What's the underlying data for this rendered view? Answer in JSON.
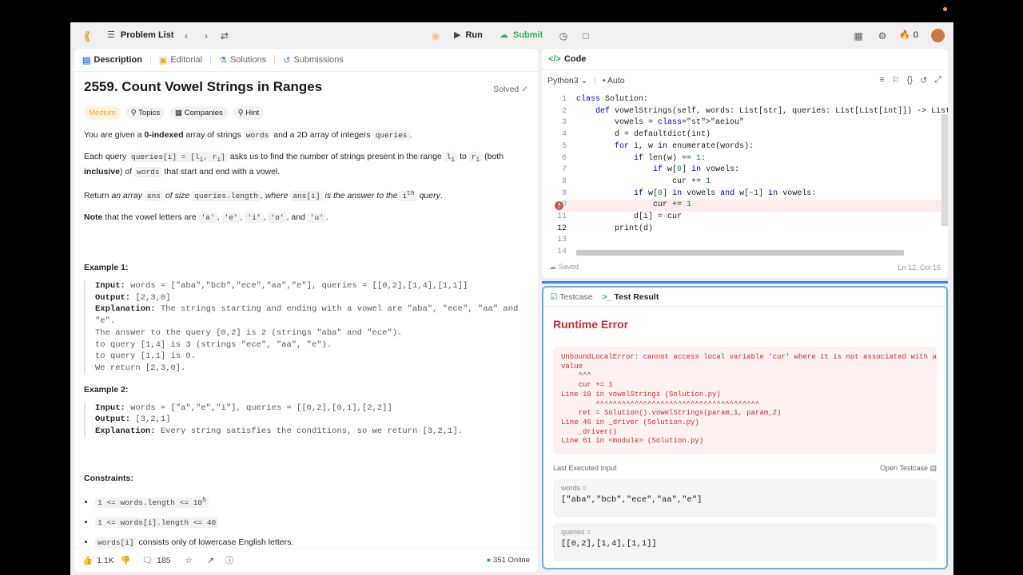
{
  "topbar": {
    "problem_list": "Problem List",
    "run": "Run",
    "submit": "Submit",
    "streak": "0"
  },
  "left_tabs": [
    {
      "label": "Description"
    },
    {
      "label": "Editorial"
    },
    {
      "label": "Solutions"
    },
    {
      "label": "Submissions"
    }
  ],
  "problem": {
    "title": "2559. Count Vowel Strings in Ranges",
    "status": "Solved",
    "difficulty": "Medium",
    "tags": [
      "Topics",
      "Companies",
      "Hint"
    ],
    "p1_a": "You are given a ",
    "p1_b": "0-indexed",
    "p1_c": " array of strings ",
    "p1_d": "words",
    "p1_e": " and a 2D array of integers ",
    "p1_f": "queries",
    "p1_g": ".",
    "p2_a": "Each query ",
    "p2_b": "queries[i] = [l",
    "p2_b2": "i",
    "p2_b3": ", r",
    "p2_b4": "i",
    "p2_b5": "]",
    "p2_c": " asks us to find the number of strings present in the range ",
    "p2_d": "l",
    "p2_d2": "i",
    "p2_e": " to ",
    "p2_f": "r",
    "p2_f2": "i",
    "p2_g": " (both ",
    "p2_h": "inclusive",
    "p2_i": ") of ",
    "p2_j": "words",
    "p2_k": " that start and end with a vowel.",
    "p3_a": "Return ",
    "p3_b": "an array ",
    "p3_c": "ans",
    "p3_d": " of size ",
    "p3_e": "queries.length",
    "p3_f": ", where ",
    "p3_g": "ans[i]",
    "p3_h": " is the answer to the ",
    "p3_i": "i",
    "p3_j": "th",
    "p3_k": " query",
    "p3_l": ".",
    "p4_a": "Note",
    "p4_b": " that the vowel letters are ",
    "p4_v1": "'a'",
    "p4_v2": "'e'",
    "p4_v3": "'i'",
    "p4_v4": "'o'",
    "p4_c": ", and ",
    "p4_v5": "'u'",
    "p4_d": ".",
    "ex1_title": "Example 1:",
    "ex1_lines": [
      {
        "k": "Input:",
        "v": " words = [\"aba\",\"bcb\",\"ece\",\"aa\",\"e\"], queries = [[0,2],[1,4],[1,1]]"
      },
      {
        "k": "Output:",
        "v": " [2,3,0]"
      },
      {
        "k": "Explanation:",
        "v": " The strings starting and ending with a vowel are \"aba\", \"ece\", \"aa\" and"
      },
      {
        "k": "",
        "v": "\"e\"."
      },
      {
        "k": "",
        "v": "The answer to the query [0,2] is 2 (strings \"aba\" and \"ece\")."
      },
      {
        "k": "",
        "v": "to query [1,4] is 3 (strings \"ece\", \"aa\", \"e\")."
      },
      {
        "k": "",
        "v": "to query [1,1] is 0."
      },
      {
        "k": "",
        "v": "We return [2,3,0]."
      }
    ],
    "ex2_title": "Example 2:",
    "ex2_lines": [
      {
        "k": "Input:",
        "v": " words = [\"a\",\"e\",\"i\"], queries = [[0,2],[0,1],[2,2]]"
      },
      {
        "k": "Output:",
        "v": " [3,2,1]"
      },
      {
        "k": "Explanation:",
        "v": " Every string satisfies the conditions, so we return [3,2,1]."
      }
    ],
    "constraints_title": "Constraints:",
    "c1": "1 <= words.length <= 10",
    "c1_sup": "5",
    "c2": "1 <= words[i].length <= 40",
    "c3_code": "words[i]",
    "c3_text": " consists only of lowercase English letters."
  },
  "bottom": {
    "likes": "1.1K",
    "comments": "185",
    "online": "351 Online"
  },
  "code": {
    "header": "Code",
    "language": "Python3",
    "mode": "Auto",
    "saved": "Saved",
    "cursor": "Ln 12, Col 16",
    "lines": [
      {
        "n": "1",
        "t": "class Solution:"
      },
      {
        "n": "2",
        "t": "    def vowelStrings(self, words: List[str], queries: List[List[int]]) -> List[in"
      },
      {
        "n": "3",
        "t": "        vowels = \"aeiou\""
      },
      {
        "n": "4",
        "t": "        d = defaultdict(int)"
      },
      {
        "n": "5",
        "t": "        for i, w in enumerate(words):"
      },
      {
        "n": "6",
        "t": "            if len(w) == 1:"
      },
      {
        "n": "7",
        "t": "                if w[0] in vowels:"
      },
      {
        "n": "8",
        "t": "                    cur += 1"
      },
      {
        "n": "9",
        "t": "            if w[0] in vowels and w[-1] in vowels:"
      },
      {
        "n": "10",
        "t": "                cur += 1"
      },
      {
        "n": "11",
        "t": "            d[i] = cur"
      },
      {
        "n": "12",
        "t": "        print(d)"
      },
      {
        "n": "13",
        "t": ""
      },
      {
        "n": "14",
        "t": ""
      }
    ]
  },
  "result": {
    "tab_testcase": "Testcase",
    "tab_result": "Test Result",
    "heading": "Runtime Error",
    "error": "UnboundLocalError: cannot access local variable 'cur' where it is not associated with a\nvalue\n    ^^^\n    cur += 1\nLine 10 in vowelStrings (Solution.py)\n        ^^^^^^^^^^^^^^^^^^^^^^^^^^^^^^^^^^^^^^\n    ret = Solution().vowelStrings(param_1, param_2)\nLine 46 in _driver (Solution.py)\n    _driver()\nLine 61 in <module> (Solution.py)",
    "last_input": "Last Executed Input",
    "open_testcase": "Open Testcase",
    "words_label": "words =",
    "words_value": "[\"aba\",\"bcb\",\"ece\",\"aa\",\"e\"]",
    "queries_label": "queries =",
    "queries_value": "[[0,2],[1,4],[1,1]]"
  }
}
